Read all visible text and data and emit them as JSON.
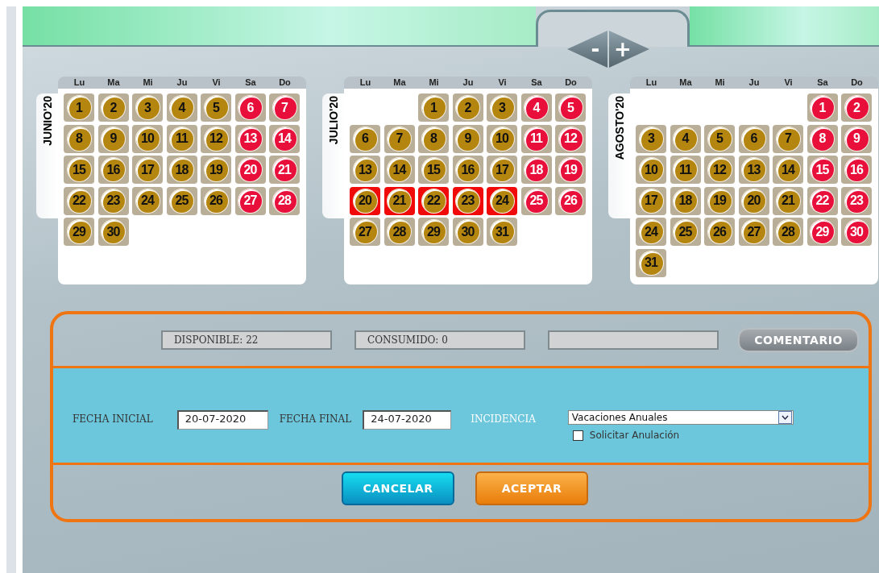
{
  "nav": {
    "previous": "-",
    "next": "+"
  },
  "months": [
    {
      "name": "JUNIO'20",
      "weekdays": [
        "Lu",
        "Ma",
        "Mi",
        "Ju",
        "Vi",
        "Sa",
        "Do"
      ],
      "weeks": [
        [
          {
            "day": "1",
            "kind": "workday",
            "selected": false
          },
          {
            "day": "2",
            "kind": "workday",
            "selected": false
          },
          {
            "day": "3",
            "kind": "workday",
            "selected": false
          },
          {
            "day": "4",
            "kind": "workday",
            "selected": false
          },
          {
            "day": "5",
            "kind": "workday",
            "selected": false
          },
          {
            "day": "6",
            "kind": "weekend",
            "selected": false
          },
          {
            "day": "7",
            "kind": "weekend",
            "selected": false
          }
        ],
        [
          {
            "day": "8",
            "kind": "workday",
            "selected": false
          },
          {
            "day": "9",
            "kind": "workday",
            "selected": false
          },
          {
            "day": "10",
            "kind": "workday",
            "selected": false
          },
          {
            "day": "11",
            "kind": "workday",
            "selected": false
          },
          {
            "day": "12",
            "kind": "workday",
            "selected": false
          },
          {
            "day": "13",
            "kind": "weekend",
            "selected": false
          },
          {
            "day": "14",
            "kind": "weekend",
            "selected": false
          }
        ],
        [
          {
            "day": "15",
            "kind": "workday",
            "selected": false
          },
          {
            "day": "16",
            "kind": "workday",
            "selected": false
          },
          {
            "day": "17",
            "kind": "workday",
            "selected": false
          },
          {
            "day": "18",
            "kind": "workday",
            "selected": false
          },
          {
            "day": "19",
            "kind": "workday",
            "selected": false
          },
          {
            "day": "20",
            "kind": "weekend",
            "selected": false
          },
          {
            "day": "21",
            "kind": "weekend",
            "selected": false
          }
        ],
        [
          {
            "day": "22",
            "kind": "workday",
            "selected": false
          },
          {
            "day": "23",
            "kind": "workday",
            "selected": false
          },
          {
            "day": "24",
            "kind": "workday",
            "selected": false
          },
          {
            "day": "25",
            "kind": "workday",
            "selected": false
          },
          {
            "day": "26",
            "kind": "workday",
            "selected": false
          },
          {
            "day": "27",
            "kind": "weekend",
            "selected": false
          },
          {
            "day": "28",
            "kind": "weekend",
            "selected": false
          }
        ],
        [
          {
            "day": "29",
            "kind": "workday",
            "selected": false
          },
          {
            "day": "30",
            "kind": "workday",
            "selected": false
          }
        ]
      ]
    },
    {
      "name": "JULIO'20",
      "weekdays": [
        "Lu",
        "Ma",
        "Mi",
        "Ju",
        "Vi",
        "Sa",
        "Do"
      ],
      "weeks": [
        [
          {
            "kind": "empty"
          },
          {
            "kind": "empty"
          },
          {
            "day": "1",
            "kind": "workday",
            "selected": false
          },
          {
            "day": "2",
            "kind": "workday",
            "selected": false
          },
          {
            "day": "3",
            "kind": "workday",
            "selected": false
          },
          {
            "day": "4",
            "kind": "weekend",
            "selected": false
          },
          {
            "day": "5",
            "kind": "weekend",
            "selected": false
          }
        ],
        [
          {
            "day": "6",
            "kind": "workday",
            "selected": false
          },
          {
            "day": "7",
            "kind": "workday",
            "selected": false
          },
          {
            "day": "8",
            "kind": "workday",
            "selected": false
          },
          {
            "day": "9",
            "kind": "workday",
            "selected": false
          },
          {
            "day": "10",
            "kind": "workday",
            "selected": false
          },
          {
            "day": "11",
            "kind": "weekend",
            "selected": false
          },
          {
            "day": "12",
            "kind": "weekend",
            "selected": false
          }
        ],
        [
          {
            "day": "13",
            "kind": "workday",
            "selected": false
          },
          {
            "day": "14",
            "kind": "workday",
            "selected": false
          },
          {
            "day": "15",
            "kind": "workday",
            "selected": false
          },
          {
            "day": "16",
            "kind": "workday",
            "selected": false
          },
          {
            "day": "17",
            "kind": "workday",
            "selected": false
          },
          {
            "day": "18",
            "kind": "weekend",
            "selected": false
          },
          {
            "day": "19",
            "kind": "weekend",
            "selected": false
          }
        ],
        [
          {
            "day": "20",
            "kind": "workday",
            "selected": true
          },
          {
            "day": "21",
            "kind": "workday",
            "selected": true
          },
          {
            "day": "22",
            "kind": "workday",
            "selected": true
          },
          {
            "day": "23",
            "kind": "workday",
            "selected": true
          },
          {
            "day": "24",
            "kind": "workday",
            "selected": true
          },
          {
            "day": "25",
            "kind": "weekend",
            "selected": false
          },
          {
            "day": "26",
            "kind": "weekend",
            "selected": false
          }
        ],
        [
          {
            "day": "27",
            "kind": "workday",
            "selected": false
          },
          {
            "day": "28",
            "kind": "workday",
            "selected": false
          },
          {
            "day": "29",
            "kind": "workday",
            "selected": false
          },
          {
            "day": "30",
            "kind": "workday",
            "selected": false
          },
          {
            "day": "31",
            "kind": "workday",
            "selected": false
          }
        ]
      ]
    },
    {
      "name": "AGOSTO'20",
      "weekdays": [
        "Lu",
        "Ma",
        "Mi",
        "Ju",
        "Vi",
        "Sa",
        "Do"
      ],
      "weeks": [
        [
          {
            "kind": "empty"
          },
          {
            "kind": "empty"
          },
          {
            "kind": "empty"
          },
          {
            "kind": "empty"
          },
          {
            "kind": "empty"
          },
          {
            "day": "1",
            "kind": "weekend",
            "selected": false
          },
          {
            "day": "2",
            "kind": "weekend",
            "selected": false
          }
        ],
        [
          {
            "day": "3",
            "kind": "workday",
            "selected": false
          },
          {
            "day": "4",
            "kind": "workday",
            "selected": false
          },
          {
            "day": "5",
            "kind": "workday",
            "selected": false
          },
          {
            "day": "6",
            "kind": "workday",
            "selected": false
          },
          {
            "day": "7",
            "kind": "workday",
            "selected": false
          },
          {
            "day": "8",
            "kind": "weekend",
            "selected": false
          },
          {
            "day": "9",
            "kind": "weekend",
            "selected": false
          }
        ],
        [
          {
            "day": "10",
            "kind": "workday",
            "selected": false
          },
          {
            "day": "11",
            "kind": "workday",
            "selected": false
          },
          {
            "day": "12",
            "kind": "workday",
            "selected": false
          },
          {
            "day": "13",
            "kind": "workday",
            "selected": false
          },
          {
            "day": "14",
            "kind": "workday",
            "selected": false
          },
          {
            "day": "15",
            "kind": "weekend",
            "selected": false
          },
          {
            "day": "16",
            "kind": "weekend",
            "selected": false
          }
        ],
        [
          {
            "day": "17",
            "kind": "workday",
            "selected": false
          },
          {
            "day": "18",
            "kind": "workday",
            "selected": false
          },
          {
            "day": "19",
            "kind": "workday",
            "selected": false
          },
          {
            "day": "20",
            "kind": "workday",
            "selected": false
          },
          {
            "day": "21",
            "kind": "workday",
            "selected": false
          },
          {
            "day": "22",
            "kind": "weekend",
            "selected": false
          },
          {
            "day": "23",
            "kind": "weekend",
            "selected": false
          }
        ],
        [
          {
            "day": "24",
            "kind": "workday",
            "selected": false
          },
          {
            "day": "25",
            "kind": "workday",
            "selected": false
          },
          {
            "day": "26",
            "kind": "workday",
            "selected": false
          },
          {
            "day": "27",
            "kind": "workday",
            "selected": false
          },
          {
            "day": "28",
            "kind": "workday",
            "selected": false
          },
          {
            "day": "29",
            "kind": "weekend",
            "selected": false
          },
          {
            "day": "30",
            "kind": "weekend",
            "selected": false
          }
        ],
        [
          {
            "day": "31",
            "kind": "workday",
            "selected": false
          }
        ]
      ]
    }
  ],
  "summary": {
    "available": "DISPONIBLE: 22",
    "consumed": "CONSUMIDO: 0",
    "comment_button": "COMENTARIO"
  },
  "form": {
    "start_label": "FECHA INICIAL",
    "start_value": "20-07-2020",
    "end_label": "FECHA FINAL",
    "end_value": "24-07-2020",
    "incident_label": "INCIDENCIA",
    "incident_value": "Vacaciones Anuales",
    "cancel_request": {
      "label": "Solicitar Anulación",
      "checked": false
    }
  },
  "buttons": {
    "cancel": "CANCELAR",
    "accept": "ACEPTAR"
  }
}
